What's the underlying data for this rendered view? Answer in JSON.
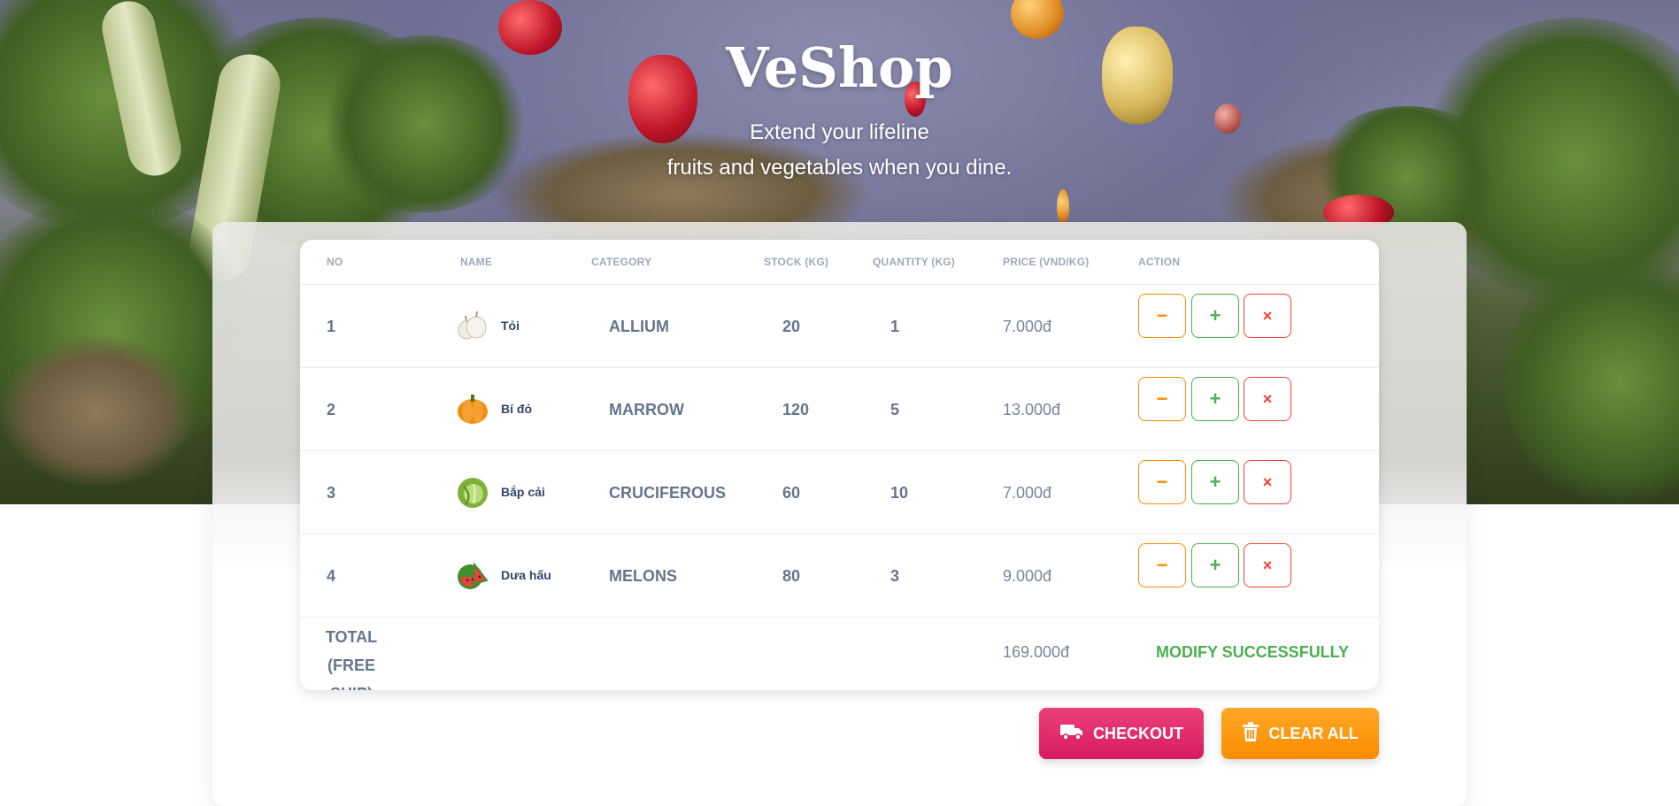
{
  "header": {
    "brand": "VeShop",
    "tagline_line1": "Extend your lifeline",
    "tagline_line2": "fruits and vegetables when you dine."
  },
  "table": {
    "columns": [
      "NO",
      "NAME",
      "CATEGORY",
      "STOCK (KG)",
      "QUANTITY (KG)",
      "PRICE (VND/KG)",
      "ACTION"
    ],
    "rows": [
      {
        "no": "1",
        "name": "Tỏi",
        "icon": "garlic-icon",
        "category": "ALLIUM",
        "stock": "20",
        "quantity": "1",
        "price": "7.000đ"
      },
      {
        "no": "2",
        "name": "Bí đỏ",
        "icon": "pumpkin-icon",
        "category": "MARROW",
        "stock": "120",
        "quantity": "5",
        "price": "13.000đ"
      },
      {
        "no": "3",
        "name": "Bắp cải",
        "icon": "cabbage-icon",
        "category": "CRUCIFEROUS",
        "stock": "60",
        "quantity": "10",
        "price": "7.000đ"
      },
      {
        "no": "4",
        "name": "Dưa hấu",
        "icon": "watermelon-icon",
        "category": "MELONS",
        "stock": "80",
        "quantity": "3",
        "price": "9.000đ"
      }
    ],
    "action_buttons": {
      "decrease": "−",
      "increase": "+",
      "remove": "×"
    },
    "total": {
      "label_line1": "TOTAL",
      "label_line2": "(FREE SHIP)",
      "price": "169.000đ",
      "status": "MODIFY SUCCESSFULLY"
    }
  },
  "actions": {
    "checkout_label": "CHECKOUT",
    "checkout_icon": "truck-icon",
    "clear_label": "CLEAR ALL",
    "clear_icon": "trash-icon"
  },
  "colors": {
    "checkout": "#d81b60",
    "clear": "#fb8c00",
    "decrease": "#fb8c00",
    "increase": "#4caf50",
    "remove": "#f44335",
    "status": "#4caf50"
  }
}
